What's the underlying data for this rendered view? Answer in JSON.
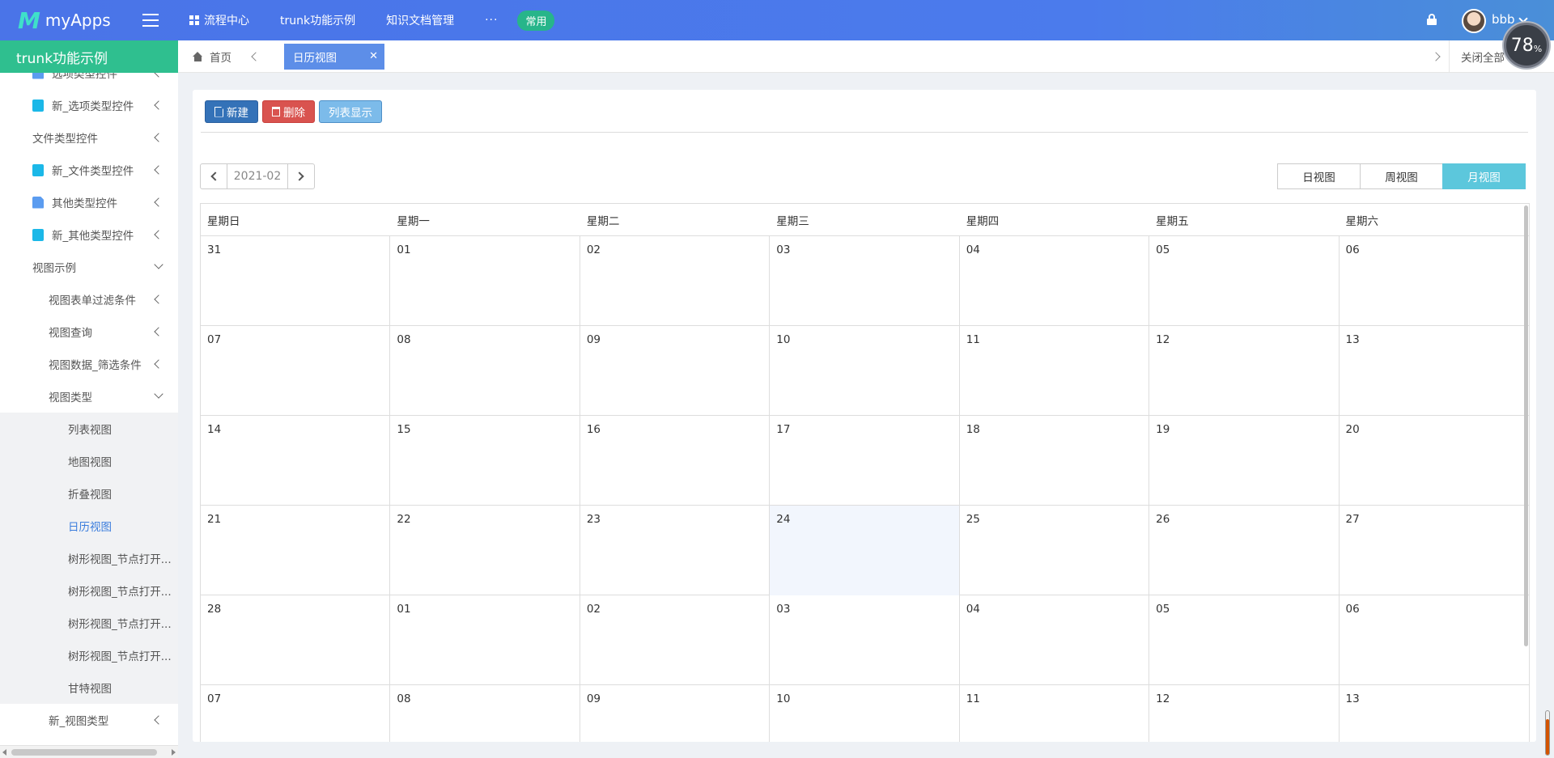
{
  "app": {
    "logo_mark": "M",
    "name": "myApps"
  },
  "topnav": {
    "items": [
      {
        "label": "流程中心",
        "icon": "grid-icon"
      },
      {
        "label": "trunk功能示例"
      },
      {
        "label": "知识文档管理"
      }
    ],
    "more": "···",
    "pill": "常用"
  },
  "user": {
    "name": "bbb"
  },
  "perf": {
    "value": "78",
    "unit": "%"
  },
  "sidebar": {
    "title": "trunk功能示例",
    "items": [
      {
        "label": "选项类型控件",
        "icon": "doc"
      },
      {
        "label": "新_选项类型控件",
        "icon": "cyan"
      },
      {
        "label": "文件类型控件"
      },
      {
        "label": "新_文件类型控件",
        "icon": "cyan"
      },
      {
        "label": "其他类型控件",
        "icon": "doc"
      },
      {
        "label": "新_其他类型控件",
        "icon": "cyan"
      },
      {
        "label": "视图示例"
      },
      {
        "label": "视图表单过滤条件"
      },
      {
        "label": "视图查询"
      },
      {
        "label": "视图数据_筛选条件"
      },
      {
        "label": "视图类型"
      },
      {
        "label": "列表视图"
      },
      {
        "label": "地图视图"
      },
      {
        "label": "折叠视图"
      },
      {
        "label": "日历视图"
      },
      {
        "label": "树形视图_节点打开..."
      },
      {
        "label": "树形视图_节点打开..."
      },
      {
        "label": "树形视图_节点打开..."
      },
      {
        "label": "树形视图_节点打开..."
      },
      {
        "label": "甘特视图"
      },
      {
        "label": "新_视图类型"
      }
    ]
  },
  "tabs": {
    "home": "首页",
    "active": "日历视图",
    "close_all": "关闭全部"
  },
  "toolbar": {
    "new": "新建",
    "delete": "删除",
    "list": "列表显示"
  },
  "calendar": {
    "month": "2021-02",
    "views": [
      "日视图",
      "周视图",
      "月视图"
    ],
    "active_view": "月视图",
    "weekdays": [
      "星期日",
      "星期一",
      "星期二",
      "星期三",
      "星期四",
      "星期五",
      "星期六"
    ],
    "weeks": [
      [
        "31",
        "01",
        "02",
        "03",
        "04",
        "05",
        "06"
      ],
      [
        "07",
        "08",
        "09",
        "10",
        "11",
        "12",
        "13"
      ],
      [
        "14",
        "15",
        "16",
        "17",
        "18",
        "19",
        "20"
      ],
      [
        "21",
        "22",
        "23",
        "24",
        "25",
        "26",
        "27"
      ],
      [
        "28",
        "01",
        "02",
        "03",
        "04",
        "05",
        "06"
      ],
      [
        "07",
        "08",
        "09",
        "10",
        "11",
        "12",
        "13"
      ]
    ],
    "today": "24"
  }
}
